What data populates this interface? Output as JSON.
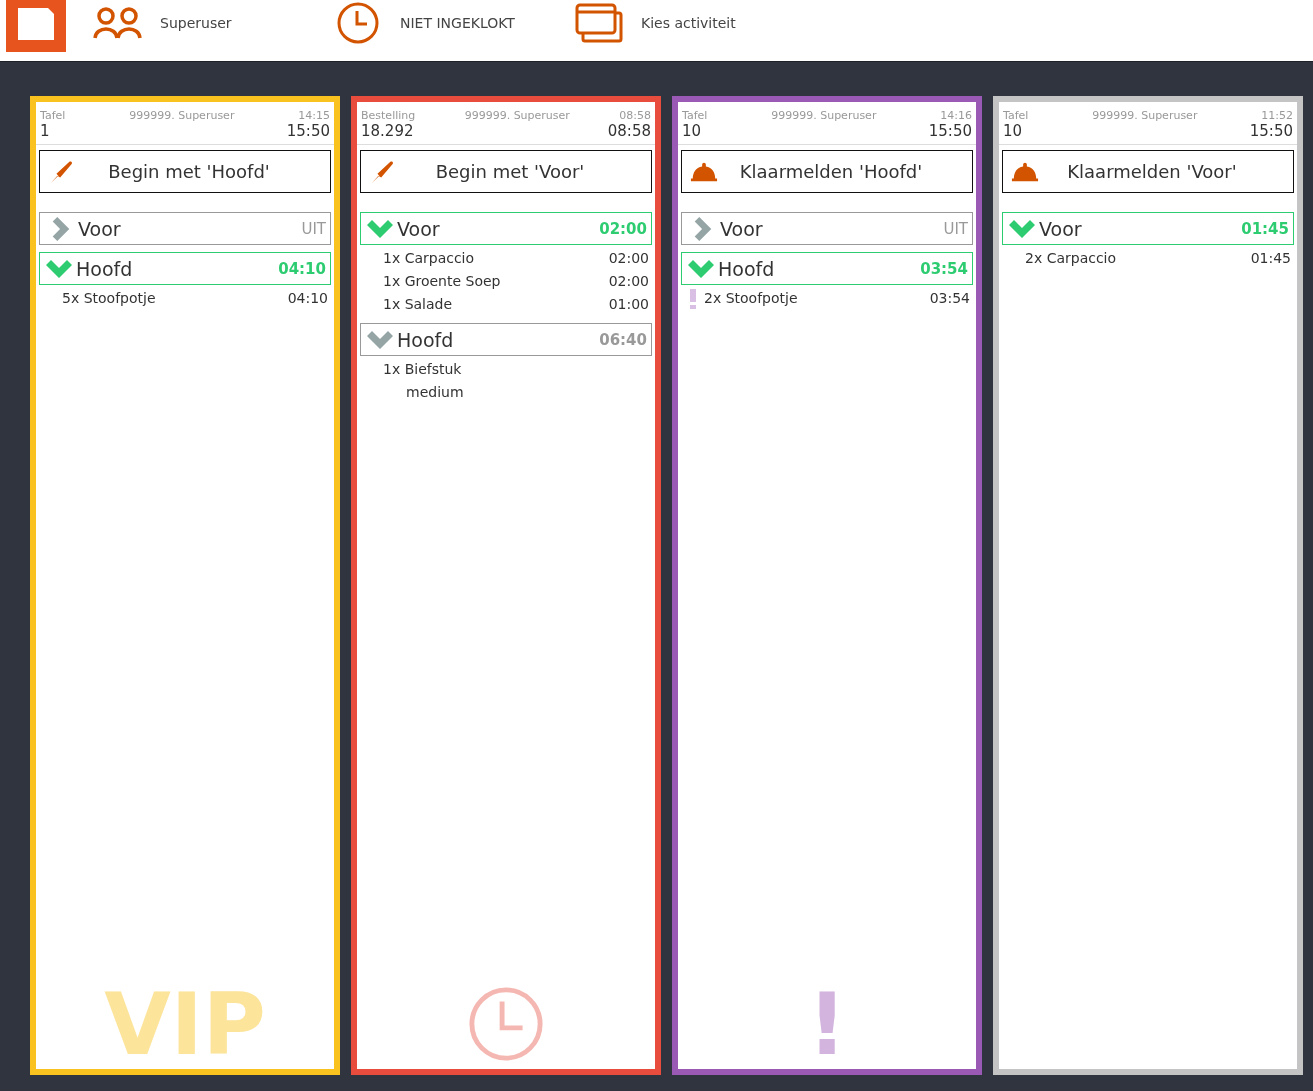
{
  "topbar": {
    "items": [
      {
        "kind": "users",
        "label": "Superuser"
      },
      {
        "kind": "clock",
        "label": "NIET INGEKLOKT"
      },
      {
        "kind": "cards",
        "label": "Kies activiteit"
      }
    ]
  },
  "orders": [
    {
      "color": "#f9c21e",
      "type_label": "Tafel",
      "user": "999999. Superuser",
      "time_small": "14:15",
      "number": "1",
      "time_big": "15:50",
      "action": {
        "kind": "knife",
        "label": "Begin met 'Hoofd'"
      },
      "courses": [
        {
          "name": "Voor",
          "kind": "off",
          "value": "UIT",
          "expanded": false,
          "active": false
        },
        {
          "name": "Hoofd",
          "kind": "timer",
          "value": "04:10",
          "expanded": true,
          "active": true,
          "items": [
            {
              "text": "5x Stoofpotje",
              "time": "04:10",
              "flagged": false
            }
          ]
        }
      ],
      "watermark": {
        "kind": "text",
        "text": "VIP"
      }
    },
    {
      "color": "#e74c3c",
      "type_label": "Bestelling",
      "user": "999999. Superuser",
      "time_small": "08:58",
      "number": "18.292",
      "time_big": "08:58",
      "action": {
        "kind": "knife",
        "label": "Begin met 'Voor'"
      },
      "courses": [
        {
          "name": "Voor",
          "kind": "timer",
          "value": "02:00",
          "expanded": true,
          "active": true,
          "items": [
            {
              "text": "1x Carpaccio",
              "time": "02:00",
              "flagged": false
            },
            {
              "text": "1x Groente Soep",
              "time": "02:00",
              "flagged": false
            },
            {
              "text": "1x Salade",
              "time": "01:00",
              "flagged": false
            }
          ]
        },
        {
          "name": "Hoofd",
          "kind": "timer",
          "value": "06:40",
          "expanded": true,
          "active": false,
          "items": [
            {
              "text": "1x Biefstuk",
              "note": "medium",
              "flagged": false
            }
          ]
        }
      ],
      "watermark": {
        "kind": "clock"
      }
    },
    {
      "color": "#9b59b6",
      "type_label": "Tafel",
      "user": "999999. Superuser",
      "time_small": "14:16",
      "number": "10",
      "time_big": "15:50",
      "action": {
        "kind": "bell",
        "label": "Klaarmelden 'Hoofd'"
      },
      "courses": [
        {
          "name": "Voor",
          "kind": "off",
          "value": "UIT",
          "expanded": false,
          "active": false
        },
        {
          "name": "Hoofd",
          "kind": "timer",
          "value": "03:54",
          "expanded": true,
          "active": true,
          "items": [
            {
              "text": "2x Stoofpotje",
              "time": "03:54",
              "flagged": true
            }
          ]
        }
      ],
      "watermark": {
        "kind": "text",
        "text": "!"
      }
    },
    {
      "color": "#c4c4c4",
      "type_label": "Tafel",
      "user": "999999. Superuser",
      "time_small": "11:52",
      "number": "10",
      "time_big": "15:50",
      "action": {
        "kind": "bell",
        "label": "Klaarmelden 'Voor'"
      },
      "courses": [
        {
          "name": "Voor",
          "kind": "timer",
          "value": "01:45",
          "expanded": true,
          "active": true,
          "items": [
            {
              "text": "2x Carpaccio",
              "time": "01:45",
              "flagged": false
            }
          ]
        }
      ]
    }
  ]
}
